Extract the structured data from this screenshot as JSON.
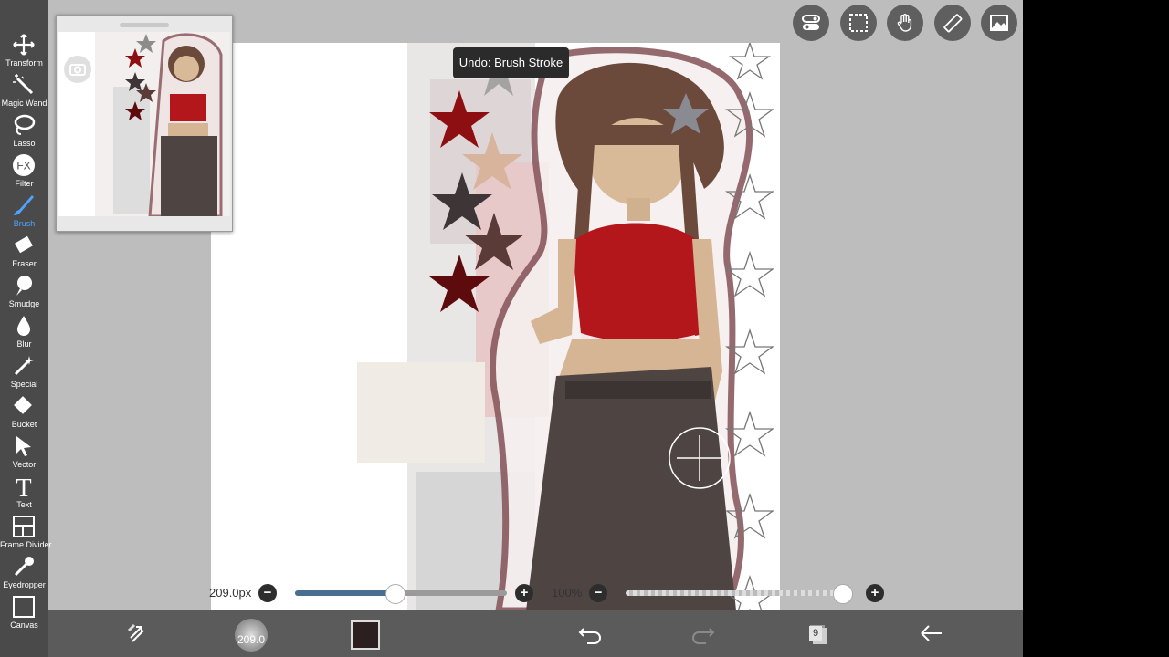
{
  "toolbar": {
    "tools": [
      {
        "label": "Transform",
        "icon": "transform-icon"
      },
      {
        "label": "Magic Wand",
        "icon": "magic-wand-icon"
      },
      {
        "label": "Lasso",
        "icon": "lasso-icon"
      },
      {
        "label": "Filter",
        "icon": "filter-icon"
      },
      {
        "label": "Brush",
        "icon": "brush-icon",
        "active": true
      },
      {
        "label": "Eraser",
        "icon": "eraser-icon"
      },
      {
        "label": "Smudge",
        "icon": "smudge-icon"
      },
      {
        "label": "Blur",
        "icon": "blur-icon"
      },
      {
        "label": "Special",
        "icon": "special-icon"
      },
      {
        "label": "Bucket",
        "icon": "bucket-icon"
      },
      {
        "label": "Vector",
        "icon": "vector-icon"
      },
      {
        "label": "Text",
        "icon": "text-icon"
      },
      {
        "label": "Frame Divider",
        "icon": "frame-divider-icon"
      },
      {
        "label": "Eyedropper",
        "icon": "eyedropper-icon"
      },
      {
        "label": "Canvas",
        "icon": "canvas-icon"
      }
    ],
    "filter_glyph": "FX",
    "text_glyph": "T"
  },
  "tooltip": "Undo: Brush Stroke",
  "brush_slider": {
    "label": "209.0px",
    "fraction": 0.47
  },
  "opacity_slider": {
    "label": "100%",
    "fraction": 1.0
  },
  "bottom": {
    "brush_size": "209.0",
    "layer_count": "9",
    "current_color": "#2b1f1f"
  },
  "top_buttons": [
    "toggle-icon",
    "selection-icon",
    "hand-icon",
    "ruler-icon",
    "image-icon"
  ],
  "colors": {
    "accent": "#4fa3ff",
    "toolbar": "#4a4a4a",
    "bottombar": "#5b5b5b",
    "star_red": "#8e0f12",
    "top_red": "#b3161b"
  }
}
